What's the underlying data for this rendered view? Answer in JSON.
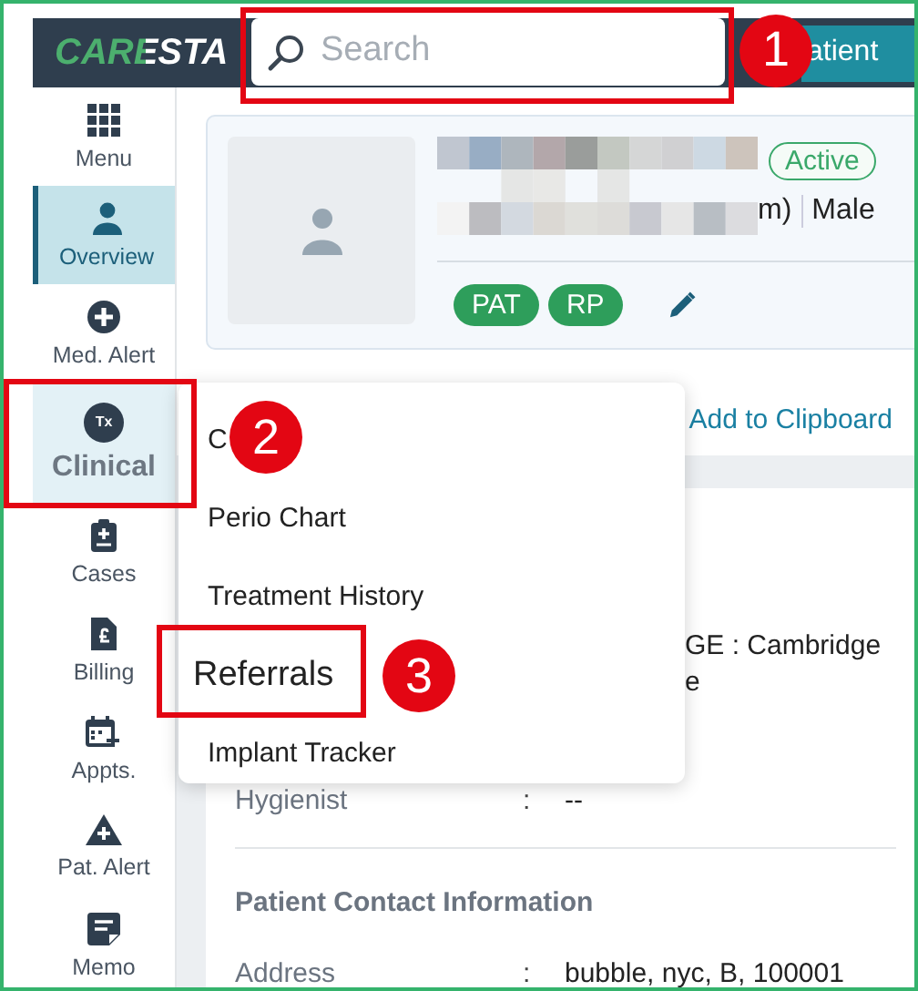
{
  "header": {
    "logo": "CARESTA",
    "search": {
      "placeholder": "Search",
      "callout": "1"
    },
    "action_button": "atient"
  },
  "sidebar": {
    "items": [
      {
        "label": "Menu",
        "selected": false
      },
      {
        "label": "Overview",
        "selected": true
      },
      {
        "label": "Med. Alert",
        "selected": false
      },
      {
        "label": "Clinical",
        "selected": false,
        "icon_text": "Tx",
        "callout": "2"
      },
      {
        "label": "Cases",
        "selected": false
      },
      {
        "label": "Billing",
        "selected": false
      },
      {
        "label": "Appts.",
        "selected": false
      },
      {
        "label": "Pat. Alert",
        "selected": false
      },
      {
        "label": "Memo",
        "selected": false
      }
    ]
  },
  "patient": {
    "status": "Active",
    "gender_fragment": "m)",
    "gender": "Male",
    "tags": [
      "PAT",
      "RP"
    ]
  },
  "toolbar": {
    "link": "Add to Clipboard"
  },
  "details": {
    "lines": [
      "GE : Cambridge",
      "e"
    ],
    "rows": [
      {
        "label": "Hygienist",
        "separator": ":",
        "value": "--"
      }
    ],
    "section_title": "Patient Contact Information",
    "contact_rows": [
      {
        "label": "Address",
        "separator": ":",
        "value": "bubble, nyc, B, 100001"
      }
    ]
  },
  "menu": {
    "items": [
      {
        "label": "C"
      },
      {
        "label": "Perio Chart"
      },
      {
        "label": "Treatment History"
      },
      {
        "label": "Referrals",
        "callout": "3"
      },
      {
        "label": "Implant Tracker"
      }
    ]
  }
}
